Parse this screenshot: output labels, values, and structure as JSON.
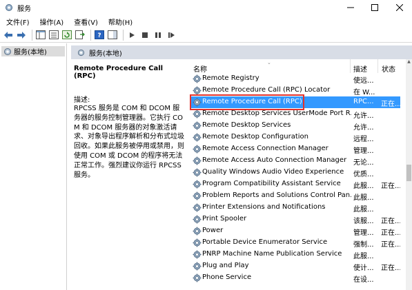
{
  "window": {
    "title": "服务"
  },
  "menu": [
    "文件(F)",
    "操作(A)",
    "查看(V)",
    "帮助(H)"
  ],
  "toolbar": {
    "buttons": [
      "back-arrow-icon",
      "forward-arrow-icon",
      "console-tree-icon",
      "properties-icon",
      "refresh-icon",
      "export-list-icon",
      "help-icon",
      "show-hide-icon",
      "start-service-icon",
      "stop-service-icon",
      "pause-service-icon",
      "restart-service-icon"
    ]
  },
  "tree": {
    "root_label": "服务(本地)"
  },
  "main": {
    "header_label": "服务(本地)",
    "detail": {
      "title": "Remote Procedure Call (RPC)",
      "desc_label": "描述:",
      "desc_text": "RPCSS 服务是 COM 和 DCOM 服务器的服务控制管理器。它执行 COM 和 DCOM 服务器的对象激活请求、对象导出程序解析和分布式垃圾回收。如果此服务被停用或禁用，则使用 COM 或 DCOM 的程序将无法正常工作。强烈建议你运行 RPCSS 服务。"
    },
    "columns": {
      "name": "名称",
      "description": "描述",
      "status": "状态"
    },
    "rows": [
      {
        "name": "Remote Registry",
        "desc": "使远...",
        "status": ""
      },
      {
        "name": "Remote Procedure Call (RPC) Locator",
        "desc": "在 W...",
        "status": ""
      },
      {
        "name": "Remote Procedure Call (RPC)",
        "desc": "RPC...",
        "status": "正在...",
        "selected": true
      },
      {
        "name": "Remote Desktop Services UserMode Port R...",
        "desc": "允许...",
        "status": ""
      },
      {
        "name": "Remote Desktop Services",
        "desc": "允许...",
        "status": ""
      },
      {
        "name": "Remote Desktop Configuration",
        "desc": "远程...",
        "status": ""
      },
      {
        "name": "Remote Access Connection Manager",
        "desc": "管理...",
        "status": ""
      },
      {
        "name": "Remote Access Auto Connection Manager",
        "desc": "无论...",
        "status": ""
      },
      {
        "name": "Quality Windows Audio Video Experience",
        "desc": "优质...",
        "status": ""
      },
      {
        "name": "Program Compatibility Assistant Service",
        "desc": "此服...",
        "status": "正在..."
      },
      {
        "name": "Problem Reports and Solutions Control Pan...",
        "desc": "此服...",
        "status": ""
      },
      {
        "name": "Printer Extensions and Notifications",
        "desc": "此服...",
        "status": ""
      },
      {
        "name": "Print Spooler",
        "desc": "该服...",
        "status": "正在..."
      },
      {
        "name": "Power",
        "desc": "管理...",
        "status": "正在..."
      },
      {
        "name": "Portable Device Enumerator Service",
        "desc": "强制...",
        "status": "正在..."
      },
      {
        "name": "PNRP Machine Name Publication Service",
        "desc": "此服...",
        "status": ""
      },
      {
        "name": "Plug and Play",
        "desc": "使计...",
        "status": "正在..."
      },
      {
        "name": "Phone Service",
        "desc": "在设...",
        "status": ""
      }
    ]
  },
  "colors": {
    "selection": "#3399ff",
    "highlight_box": "#e4322b",
    "header_bg": "#d8dde6"
  }
}
